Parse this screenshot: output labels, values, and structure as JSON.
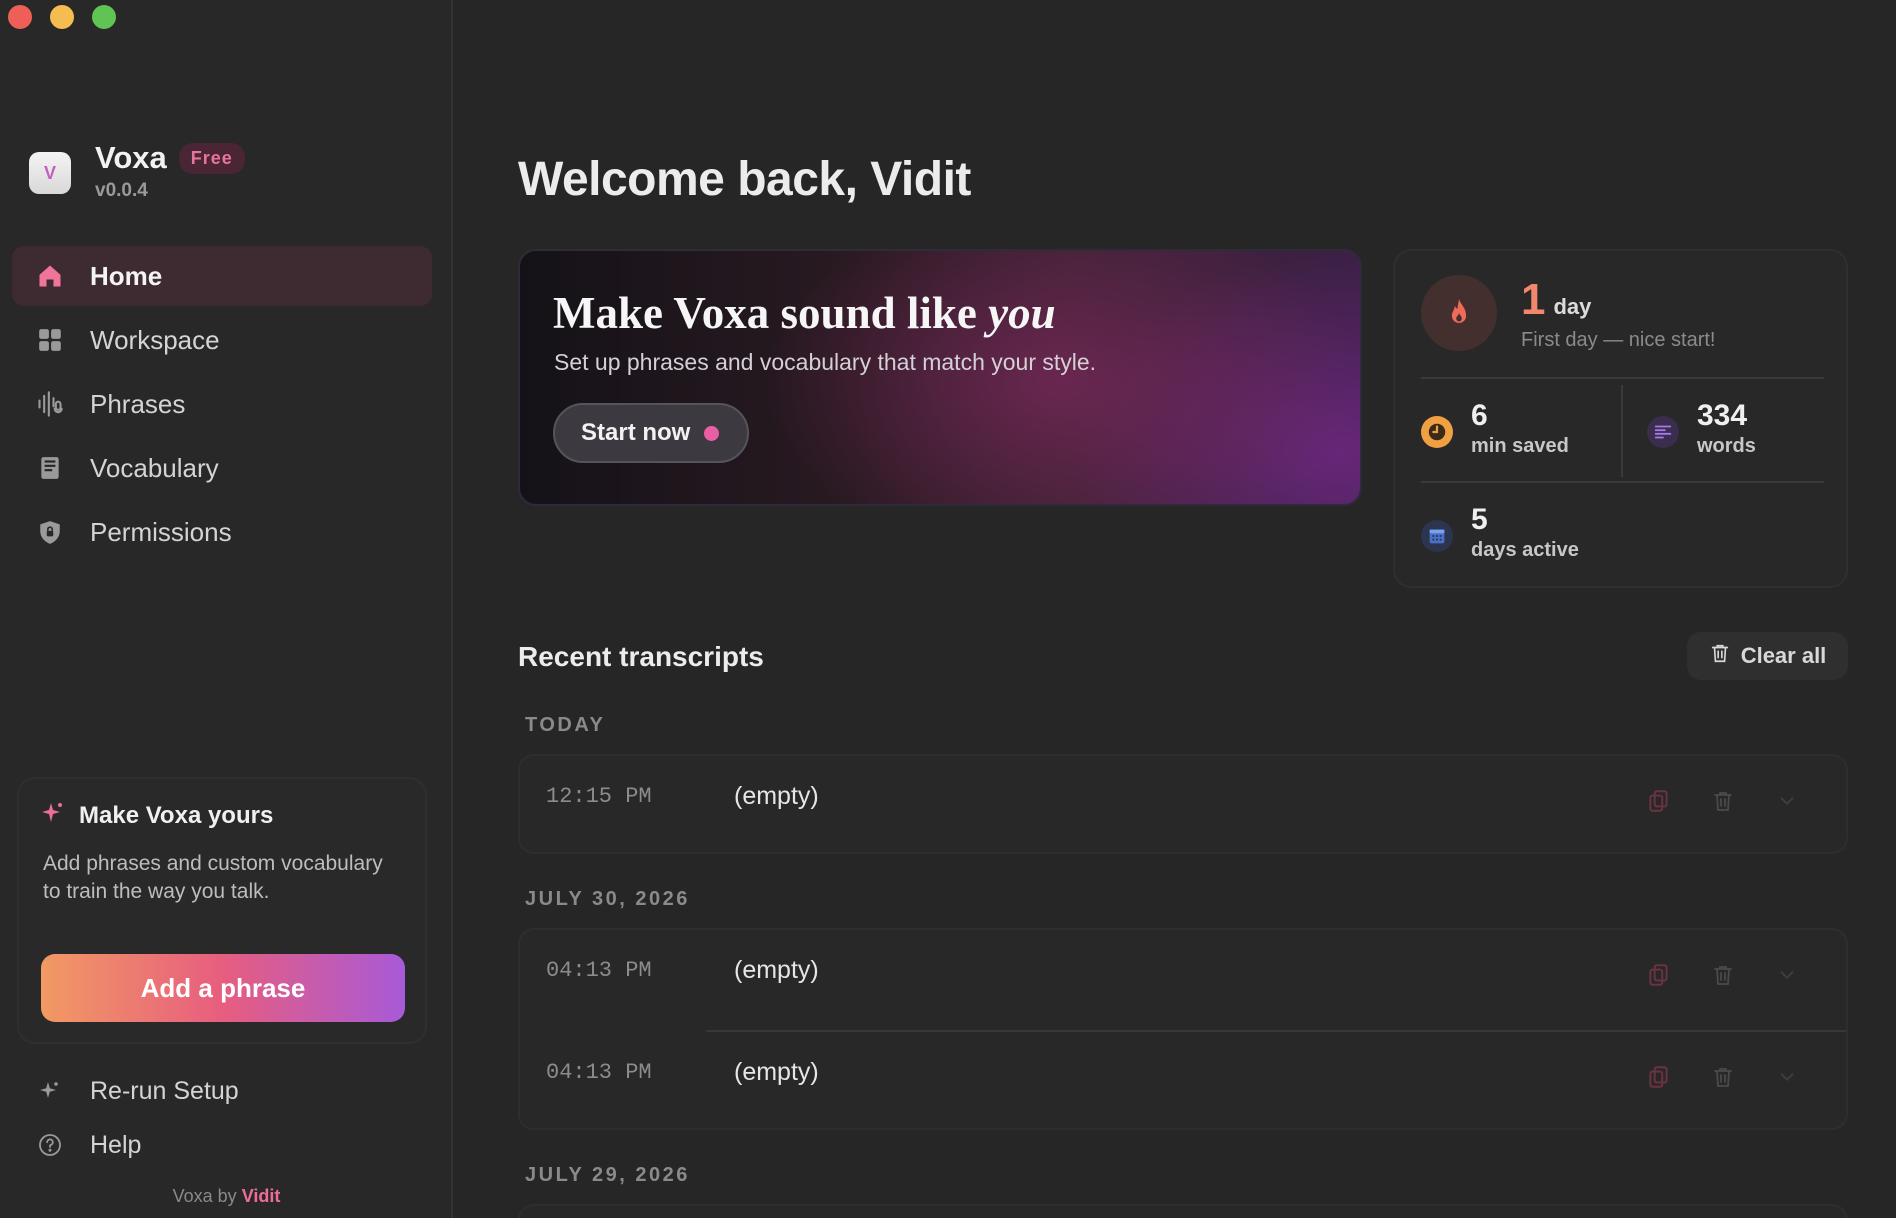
{
  "app": {
    "name": "Voxa",
    "plan_badge": "Free",
    "version": "v0.0.4",
    "logo_letter": "V"
  },
  "sidebar": {
    "nav": [
      {
        "label": "Home",
        "icon": "home-icon",
        "active": true
      },
      {
        "label": "Workspace",
        "icon": "grid-icon",
        "active": false
      },
      {
        "label": "Phrases",
        "icon": "waveform-mic-icon",
        "active": false
      },
      {
        "label": "Vocabulary",
        "icon": "book-icon",
        "active": false
      },
      {
        "label": "Permissions",
        "icon": "shield-lock-icon",
        "active": false
      }
    ],
    "promo": {
      "title": "Make Voxa yours",
      "description": "Add phrases and custom vocabulary to train the way you talk.",
      "button_label": "Add a phrase"
    },
    "footer": [
      {
        "label": "Re-run Setup",
        "icon": "sparkle-icon"
      },
      {
        "label": "Help",
        "icon": "help-circle-icon"
      }
    ],
    "credit_prefix": "Voxa by",
    "credit_name": "Vidit"
  },
  "main": {
    "welcome": "Welcome back, Vidit",
    "hero": {
      "title_prefix": "Make Voxa sound like",
      "title_emphasis": "you",
      "subtitle": "Set up phrases and vocabulary that match your style.",
      "button_label": "Start now"
    },
    "stats": {
      "streak_value": "1",
      "streak_unit": "day",
      "streak_message": "First day — nice start!",
      "time_saved_value": "6",
      "time_saved_label": "min saved",
      "words_value": "334",
      "words_label": "words",
      "days_active_value": "5",
      "days_active_label": "days active"
    },
    "transcripts": {
      "title": "Recent transcripts",
      "clear_label": "Clear all",
      "groups": [
        {
          "date": "TODAY",
          "items": [
            {
              "time": "12:15 PM",
              "text": "(empty)"
            }
          ]
        },
        {
          "date": "JULY 30, 2026",
          "items": [
            {
              "time": "04:13 PM",
              "text": "(empty)"
            },
            {
              "time": "04:13 PM",
              "text": "(empty)"
            }
          ]
        },
        {
          "date": "JULY 29, 2026",
          "items": []
        }
      ]
    }
  },
  "colors": {
    "accent_pink": "#ee6d97",
    "streak_orange": "#f3876e",
    "background": "#262626"
  }
}
